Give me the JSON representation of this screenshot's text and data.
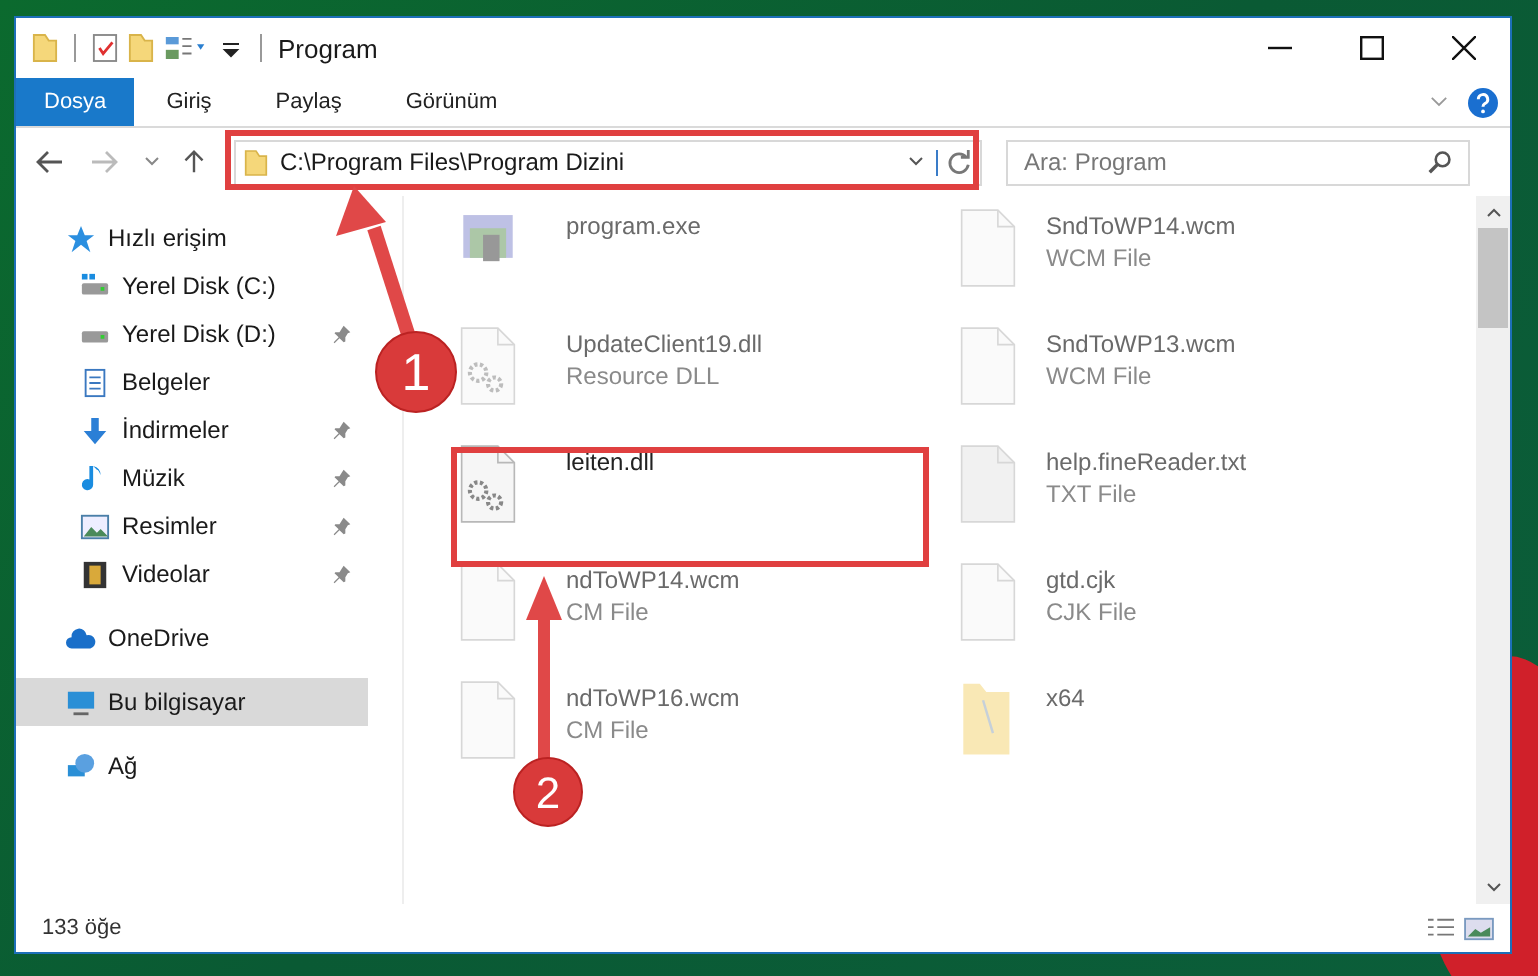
{
  "window": {
    "title": "Program"
  },
  "ribbon_tabs": [
    {
      "label": "Dosya",
      "selected": true
    },
    {
      "label": "Giriş",
      "selected": false
    },
    {
      "label": "Paylaş",
      "selected": false
    },
    {
      "label": "Görünüm",
      "selected": false
    }
  ],
  "address_bar": {
    "path": "C:\\Program Files\\Program Dizini"
  },
  "search": {
    "placeholder": "Ara: Program"
  },
  "sidebar": {
    "items": [
      {
        "label": "Hızlı erişim",
        "kind": "quick",
        "selected": false,
        "children": [
          {
            "label": "Yerel Disk (C:)",
            "kind": "drive-c",
            "pinned": false,
            "selected": false
          },
          {
            "label": "Yerel Disk (D:)",
            "kind": "drive",
            "pinned": true,
            "selected": false
          },
          {
            "label": "Belgeler",
            "kind": "documents",
            "pinned": false,
            "selected": false
          },
          {
            "label": "İndirmeler",
            "kind": "downloads",
            "pinned": true,
            "selected": false
          },
          {
            "label": "Müzik",
            "kind": "music",
            "pinned": true,
            "selected": false
          },
          {
            "label": "Resimler",
            "kind": "pictures",
            "pinned": true,
            "selected": false
          },
          {
            "label": "Videolar",
            "kind": "videos",
            "pinned": true,
            "selected": false
          }
        ]
      },
      {
        "label": "OneDrive",
        "kind": "cloud",
        "selected": false
      },
      {
        "label": "Bu bilgisayar",
        "kind": "computer",
        "selected": true
      },
      {
        "label": "Ağ",
        "kind": "network",
        "selected": false
      }
    ]
  },
  "files": [
    {
      "name": "program.exe",
      "kind": "exe",
      "blurred": true
    },
    {
      "name": "SndToWP14.wcm",
      "type": "WCM File",
      "kind": "file",
      "blurred": true
    },
    {
      "name": "UpdateClient19.dll",
      "type": "Resource DLL",
      "kind": "dll",
      "blurred": true
    },
    {
      "name": "SndToWP13.wcm",
      "type": "WCM File",
      "kind": "file",
      "blurred": true
    },
    {
      "name": "leiten.dll",
      "kind": "dll",
      "blurred": false
    },
    {
      "name": "help.fineReader.txt",
      "type": "TXT File",
      "kind": "txt",
      "blurred": true
    },
    {
      "name": "ndToWP14.wcm",
      "type": "CM File",
      "kind": "file",
      "blurred": true
    },
    {
      "name": "gtd.cjk",
      "type": "CJK File",
      "kind": "file",
      "blurred": true
    },
    {
      "name": "ndToWP16.wcm",
      "type": "CM File",
      "kind": "file",
      "blurred": true
    },
    {
      "name": "x64",
      "kind": "folder",
      "blurred": true
    }
  ],
  "status_bar": {
    "item_count": "133 öğe"
  },
  "annotations": [
    {
      "label": "1"
    },
    {
      "label": "2"
    }
  ]
}
